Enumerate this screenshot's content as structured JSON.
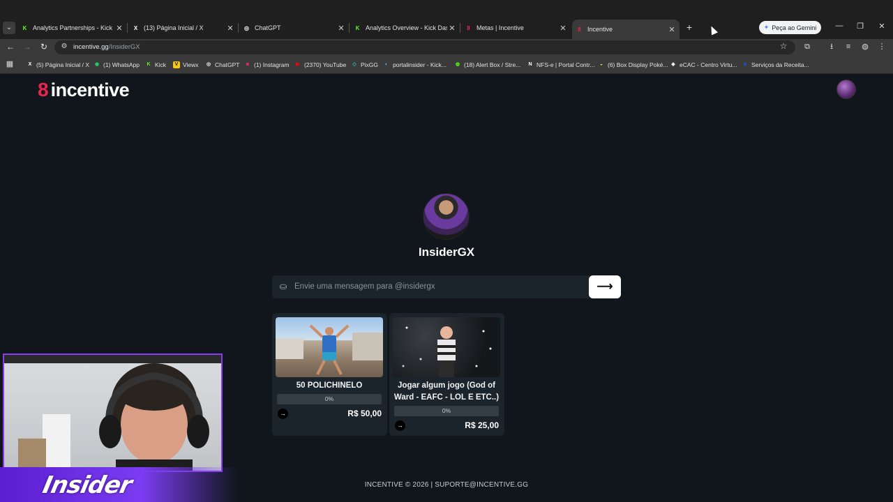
{
  "browser": {
    "tabs": [
      {
        "title": "Analytics Partnerships - Kick Da",
        "favicon": "K",
        "favicon_color": "#53fc18",
        "active": false
      },
      {
        "title": "(13) Página Inicial / X",
        "favicon": "X",
        "favicon_color": "#ffffff",
        "active": false
      },
      {
        "title": "ChatGPT",
        "favicon": "◎",
        "favicon_color": "#ffffff",
        "active": false
      },
      {
        "title": "Analytics Overview - Kick Dashb",
        "favicon": "K",
        "favicon_color": "#53fc18",
        "active": false
      },
      {
        "title": "Metas | Incentive",
        "favicon": "8",
        "favicon_color": "#e8254f",
        "active": false
      },
      {
        "title": "Incentive",
        "favicon": "8",
        "favicon_color": "#e8254f",
        "active": true
      }
    ],
    "gemini_label": "Peça ao Gemini",
    "url_host": "incentive.gg",
    "url_path": "/InsiderGX",
    "bookmarks": [
      {
        "label": "(5) Página Inicial / X",
        "favicon": "X",
        "color": "#ffffff"
      },
      {
        "label": "(1) WhatsApp",
        "favicon": "◉",
        "color": "#25d366"
      },
      {
        "label": "Kick",
        "favicon": "K",
        "color": "#53fc18"
      },
      {
        "label": "Viewx",
        "favicon": "V",
        "color": "#f5c518"
      },
      {
        "label": "ChatGPT",
        "favicon": "◎",
        "color": "#ffffff"
      },
      {
        "label": "(1) Instagram",
        "favicon": "◙",
        "color": "#e1306c"
      },
      {
        "label": "(2370) YouTube",
        "favicon": "▶",
        "color": "#ff0000"
      },
      {
        "label": "PixGG",
        "favicon": "◇",
        "color": "#32bcad"
      },
      {
        "label": "portalinsider - Kick...",
        "favicon": "◐",
        "color": "#7aa7ff"
      },
      {
        "label": "(18) Alert Box / Stre...",
        "favicon": "◍",
        "color": "#53fc18"
      },
      {
        "label": "NFS-e | Portal Contr...",
        "favicon": "N",
        "color": "#ffffff"
      },
      {
        "label": "(6) Box Display Poké...",
        "favicon": "◒",
        "color": "#d4e157"
      },
      {
        "label": "eCAC - Centro Virtu...",
        "favicon": "◈",
        "color": "#ffffff"
      },
      {
        "label": "Serviços da Receita...",
        "favicon": "◆",
        "color": "#1e4fa8"
      }
    ]
  },
  "site": {
    "logo_mark": "8",
    "logo_text": "incentive",
    "brand_color": "#e8254f",
    "profile_name": "InsiderGX",
    "message_placeholder": "Envie uma mensagem para @insidergx",
    "send_icon": "arrow-right-icon",
    "goals": [
      {
        "title": "50 POLICHINELO",
        "progress_label": "0%",
        "progress": 0,
        "price": "R$ 50,00"
      },
      {
        "title": "Jogar algum jogo (God of Ward - EAFC - LOL E ETC..)",
        "progress_label": "0%",
        "progress": 0,
        "price": "R$ 25,00"
      }
    ],
    "footer": "INCENTIVE © 2026 | SUPORTE@INCENTIVE.GG"
  },
  "overlay": {
    "banner_text": "Insider",
    "accent_color": "#7b3cf2"
  }
}
